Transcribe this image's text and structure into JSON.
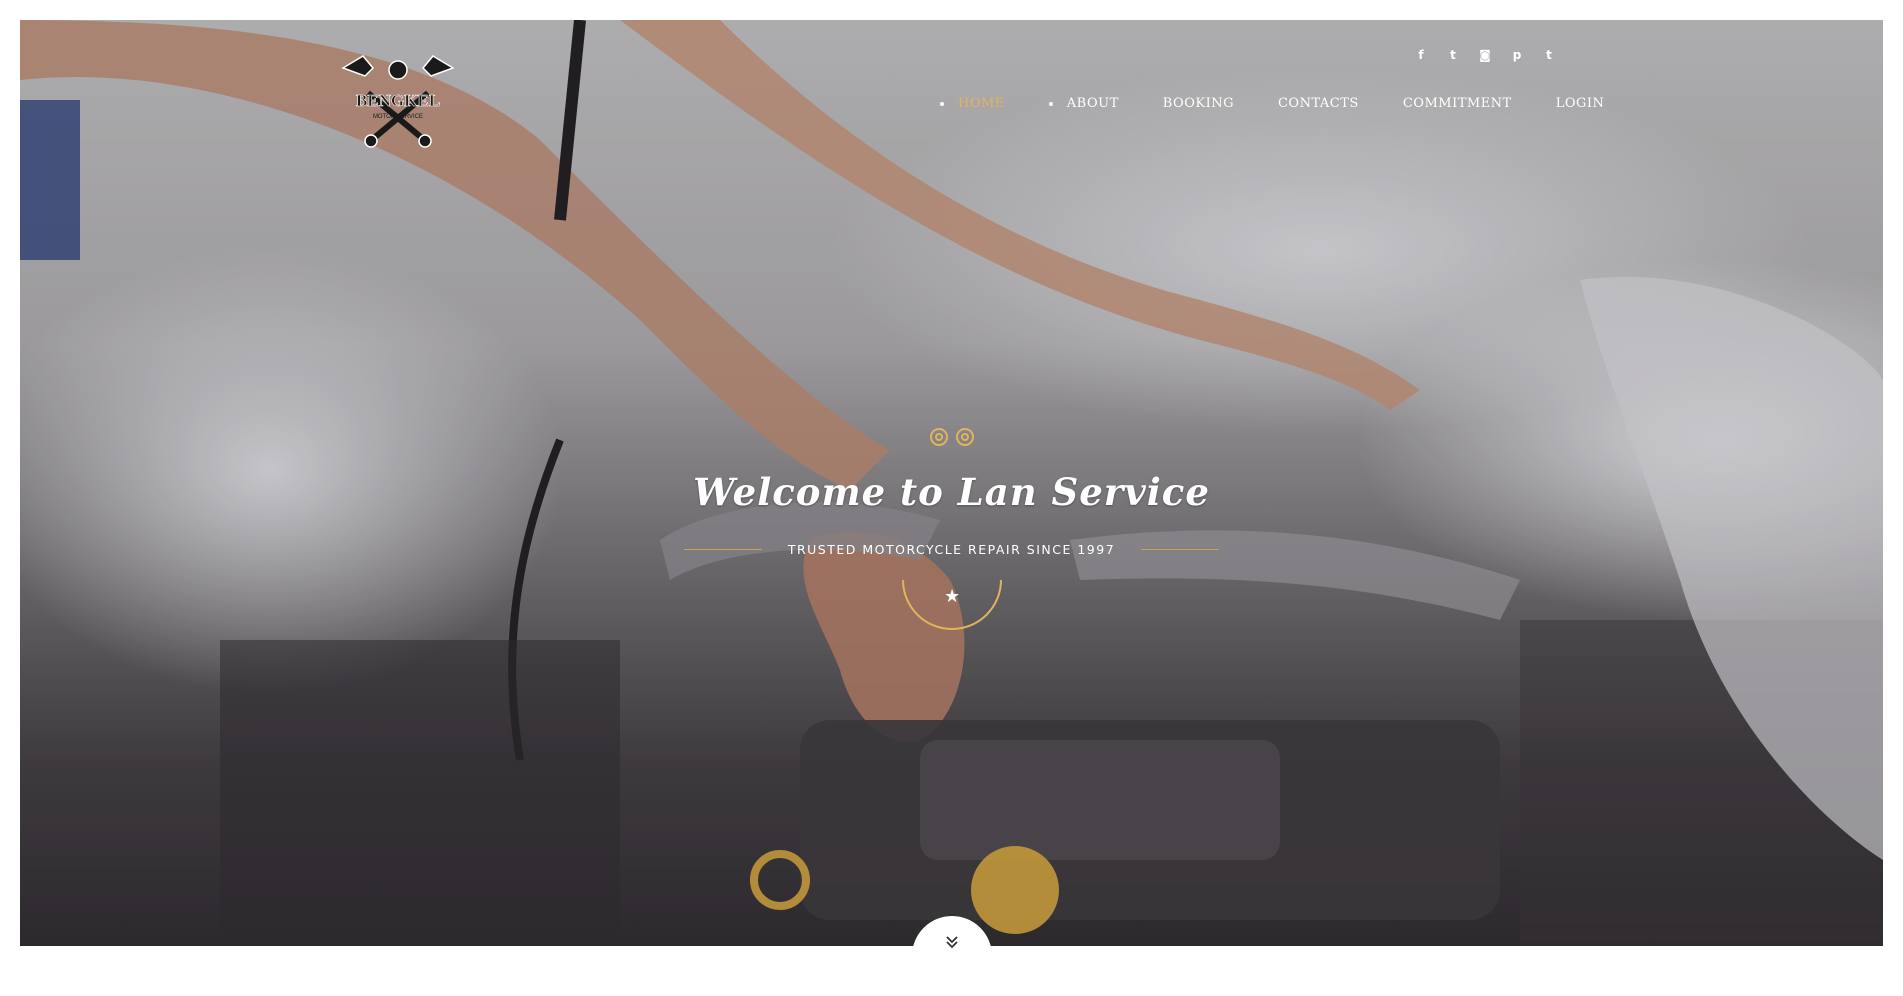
{
  "logo": {
    "name": "BENGKEL",
    "sub": "MOTOR SERVICE"
  },
  "social": [
    {
      "icon": "facebook-icon",
      "glyph": "f"
    },
    {
      "icon": "twitter-icon",
      "glyph": "t"
    },
    {
      "icon": "instagram-icon",
      "glyph": "◙"
    },
    {
      "icon": "pinterest-icon",
      "glyph": "p"
    },
    {
      "icon": "tumblr-icon",
      "glyph": "t"
    }
  ],
  "nav": {
    "items": [
      {
        "label": "HOME",
        "active": true
      },
      {
        "label": "ABOUT",
        "active": false
      },
      {
        "label": "BOOKING",
        "active": false
      },
      {
        "label": "CONTACTS",
        "active": false
      },
      {
        "label": "COMMITMENT",
        "active": false
      },
      {
        "label": "LOGIN",
        "active": false
      }
    ]
  },
  "hero": {
    "title": "Welcome to Lan Service",
    "tagline": "TRUSTED MOTORCYCLE REPAIR SINCE 1997",
    "star_glyph": "★",
    "scroll_glyph": "⌄"
  },
  "colors": {
    "accent": "#e0b45c",
    "text": "#ffffff"
  }
}
